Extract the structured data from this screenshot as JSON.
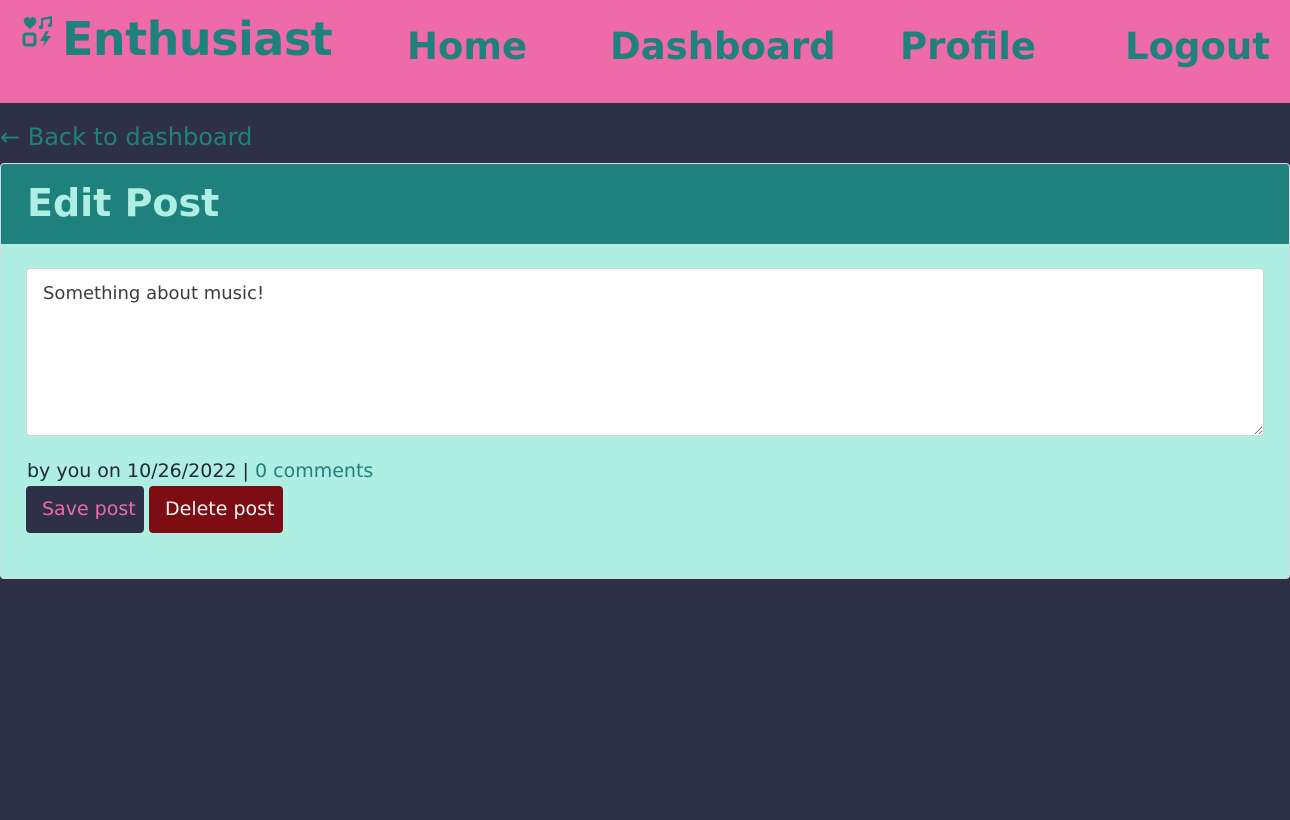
{
  "navbar": {
    "brand": "Enthusiast",
    "brand_icon": "music-heart-icon",
    "links": {
      "home": "Home",
      "dashboard": "Dashboard",
      "profile": "Profile",
      "logout": "Logout"
    }
  },
  "back_link": "← Back to dashboard",
  "card": {
    "title": "Edit Post",
    "post_body": "Something about music!",
    "meta": {
      "prefix": "by you on 10/26/2022 | ",
      "comments": "0 comments"
    },
    "buttons": {
      "save": "Save post",
      "delete": "Delete post"
    }
  },
  "colors": {
    "navbar_bg": "#ef6aa8",
    "accent": "#1f817d",
    "page_bg": "#2e3047",
    "card_bg": "#afeee3",
    "delete_bg": "#7d0d13"
  }
}
